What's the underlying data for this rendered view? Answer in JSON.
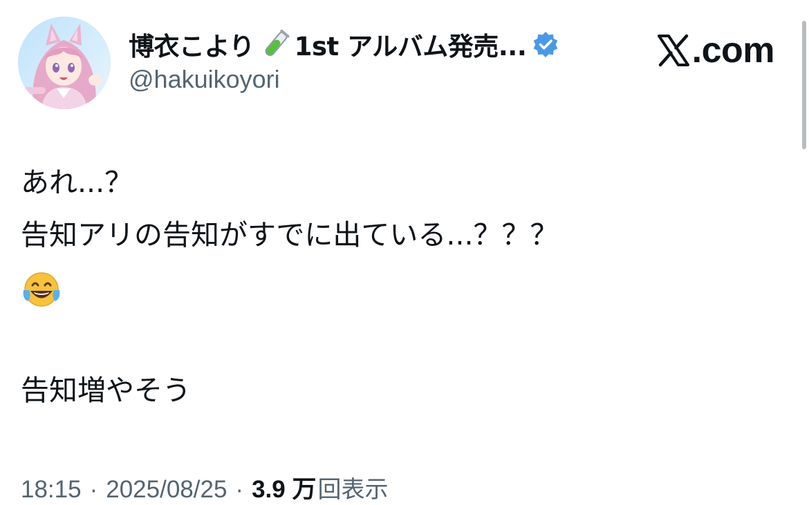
{
  "author": {
    "display_name": "博衣こより",
    "display_name_suffix": "1st アルバム発売...",
    "handle": "@hakuikoyori",
    "verified_icon": "verified-badge-icon",
    "verified_color": "#4a99e9",
    "name_emoji_icon": "test-tube-icon"
  },
  "brand": {
    "logo_icon": "x-logo-icon",
    "text": ".com"
  },
  "tweet": {
    "line1": "あれ...？",
    "line2": "告知アリの告知がすでに出ている...？？？",
    "emoji_icon": "face-with-tears-of-joy-icon",
    "line4": "告知増やそう"
  },
  "meta": {
    "time": "18:15",
    "date": "2025/08/25",
    "separator": "·",
    "views_count": "3.9 万",
    "views_label": "回表示"
  },
  "colors": {
    "text": "#0f1419",
    "secondary": "#536471",
    "background": "#ffffff"
  }
}
